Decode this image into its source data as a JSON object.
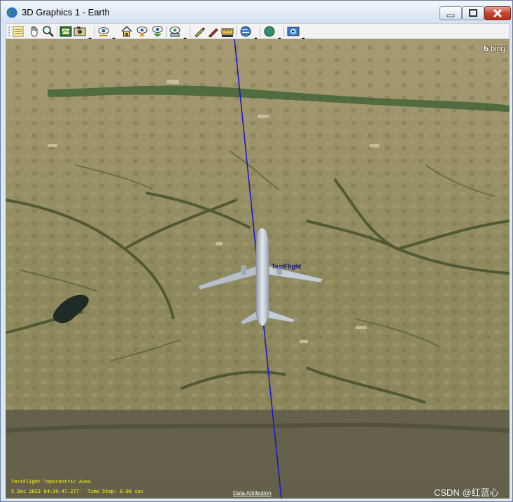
{
  "window": {
    "title": "3D Graphics 1 - Earth",
    "controls": {
      "minimize": "minimize",
      "maximize": "maximize",
      "close": "close"
    }
  },
  "toolbar": {
    "buttons": [
      {
        "icon": "properties-icon"
      },
      {
        "icon": "pan-hand-icon"
      },
      {
        "icon": "zoom-icon"
      },
      {
        "icon": "map-snapshot-icon"
      },
      {
        "icon": "camera-snapshot-icon",
        "dropdown": true
      },
      {
        "icon": "view-from-to-icon",
        "dropdown": true
      },
      {
        "icon": "home-view-icon"
      },
      {
        "icon": "orient-north-icon"
      },
      {
        "icon": "top-down-view-icon"
      },
      {
        "icon": "globe-layers-icon",
        "dropdown": true
      },
      {
        "icon": "measure-pencil-icon"
      },
      {
        "icon": "draw-pencil-icon"
      },
      {
        "icon": "ruler-icon"
      },
      {
        "icon": "globe-manager-icon",
        "dropdown": true
      },
      {
        "icon": "terrain-globe-icon",
        "dropdown": true
      },
      {
        "icon": "record-movie-icon",
        "dropdown": true
      }
    ]
  },
  "viewport": {
    "map_provider": "bing",
    "object_label": "TestFlight",
    "hud": {
      "line1": "TestFlight Topocentric Axes",
      "date": "5 Dec 2023 04:39:47.277",
      "time_step": "Time Step: 0.00 sec"
    },
    "data_attribution": "Data Attribution",
    "watermark": "CSDN @红蓝心"
  },
  "colors": {
    "trajectory_line": "#1a1acd",
    "hud_text": "#ffff00",
    "title_bar": "#dbe6f3",
    "close_button": "#c7432f"
  }
}
